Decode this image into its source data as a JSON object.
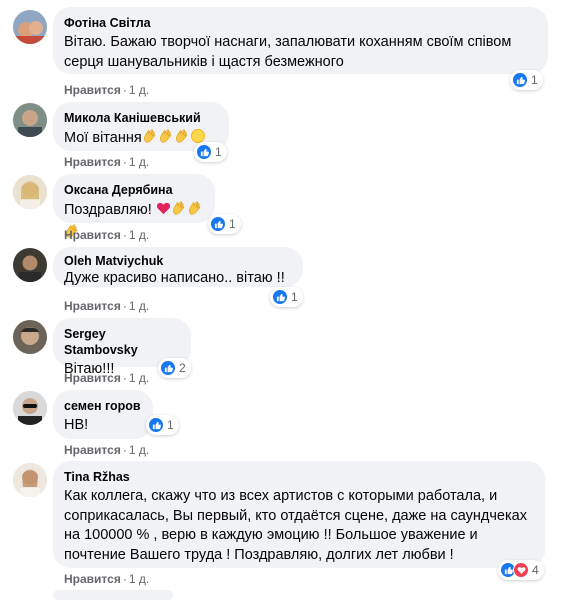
{
  "like_label": "Нравится",
  "comments": [
    {
      "author": "Фотіна Світла",
      "text": "Вітаю. Бажаю творчої наснаги, запалювати коханням своїм співом серця шанувальників і щастя безмежного",
      "time": "1 д.",
      "reactions": [
        "like"
      ],
      "reaction_count": "1"
    },
    {
      "author": "Микола Канішевський",
      "text": "Мої вітання",
      "emojis": [
        "clap-emoji",
        "clap-emoji",
        "clap-emoji",
        "sun-emoji"
      ],
      "time": "1 д.",
      "reactions": [
        "like"
      ],
      "reaction_count": "1"
    },
    {
      "author": "Оксана Дерябина",
      "text": "Поздравляю!",
      "emojis": [
        "heart-emoji",
        "clap-emoji",
        "clap-emoji",
        "clap-emoji"
      ],
      "time": "1 д.",
      "reactions": [
        "like"
      ],
      "reaction_count": "1"
    },
    {
      "author": "Oleh Matviychuk",
      "text": "Дуже красиво написано.. вітаю !!",
      "time": "1 д.",
      "reactions": [
        "like"
      ],
      "reaction_count": "1"
    },
    {
      "author": "Sergey Stambovsky",
      "text": "Вітаю!!!",
      "time": "1 д.",
      "reactions": [
        "like"
      ],
      "reaction_count": "2"
    },
    {
      "author": "семен горов",
      "text": "НВ!",
      "time": "1 д.",
      "reactions": [
        "like"
      ],
      "reaction_count": "1"
    },
    {
      "author": "Tina Ržhas",
      "text_lines": [
        "Как коллега, скажу что из всех артистов с которыми работала, и",
        "соприкасалась, Вы первый, кто отдаётся сцене, даже на саундчеках",
        "на 100000 % , верю в каждую эмоцию !! Большое уважение и",
        "почтение Вашего труда ! Поздравляю, долгих лет любви !"
      ],
      "time": "1 д.",
      "reactions": [
        "like",
        "love"
      ],
      "reaction_count": "4"
    }
  ],
  "colors": {
    "bubble": "#f0f2f5",
    "like_blue": "#1877f2",
    "love_red": "#f33e58",
    "meta": "#65676b"
  }
}
